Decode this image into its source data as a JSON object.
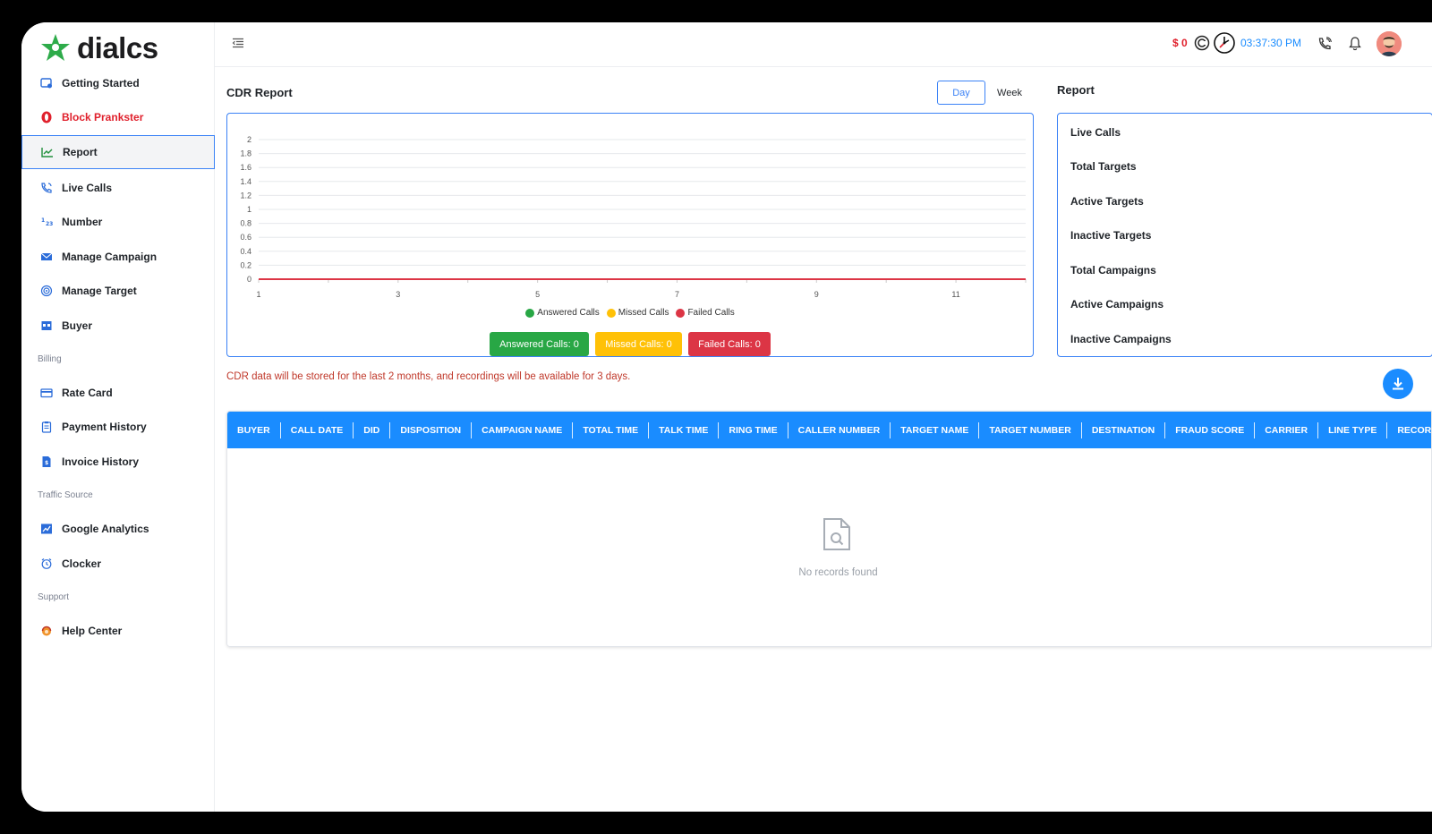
{
  "brand": {
    "name": "dialcs"
  },
  "sidebar": {
    "items": [
      {
        "label": "Getting Started"
      },
      {
        "label": "Block Prankster"
      },
      {
        "label": "Report"
      },
      {
        "label": "Live Calls"
      },
      {
        "label": "Number"
      },
      {
        "label": "Manage Campaign"
      },
      {
        "label": "Manage Target"
      },
      {
        "label": "Buyer"
      }
    ],
    "billing": {
      "heading": "Billing",
      "items": [
        {
          "label": "Rate Card"
        },
        {
          "label": "Payment History"
        },
        {
          "label": "Invoice History"
        }
      ]
    },
    "traffic": {
      "heading": "Traffic Source",
      "items": [
        {
          "label": "Google Analytics"
        },
        {
          "label": "Clocker"
        }
      ]
    },
    "support": {
      "heading": "Support",
      "items": [
        {
          "label": "Help Center"
        }
      ]
    }
  },
  "topbar": {
    "balance": "$ 0",
    "time": "03:37:30 PM"
  },
  "cdr": {
    "title": "CDR Report",
    "toggle": {
      "day": "Day",
      "week": "Week"
    },
    "answered_btn": "Answered Calls: 0",
    "missed_btn": "Missed Calls: 0",
    "failed_btn": "Failed Calls: 0",
    "notice": "CDR data will be stored for the last 2 months, and recordings will be available for 3 days."
  },
  "chart_data": {
    "type": "line",
    "x": [
      1,
      2,
      3,
      4,
      5,
      6,
      7,
      8,
      9,
      10,
      11,
      12
    ],
    "x_tick_labels": [
      "1",
      "3",
      "5",
      "7",
      "9",
      "11"
    ],
    "y_tick_labels": [
      "2",
      "1.8",
      "1.6",
      "1.4",
      "1.2",
      "1",
      "0.8",
      "0.6",
      "0.4",
      "0.2",
      "0"
    ],
    "ylim": [
      0,
      2
    ],
    "series": [
      {
        "name": "Answered Calls",
        "color": "#28a745",
        "values": [
          0,
          0,
          0,
          0,
          0,
          0,
          0,
          0,
          0,
          0,
          0,
          0
        ]
      },
      {
        "name": "Missed Calls",
        "color": "#ffc107",
        "values": [
          0,
          0,
          0,
          0,
          0,
          0,
          0,
          0,
          0,
          0,
          0,
          0
        ]
      },
      {
        "name": "Failed Calls",
        "color": "#dc3545",
        "values": [
          0,
          0,
          0,
          0,
          0,
          0,
          0,
          0,
          0,
          0,
          0,
          0
        ]
      }
    ],
    "grid": true,
    "legend": "bottom"
  },
  "report": {
    "title": "Report",
    "items": [
      {
        "label": "Live Calls"
      },
      {
        "label": "Total Targets"
      },
      {
        "label": "Active Targets"
      },
      {
        "label": "Inactive Targets"
      },
      {
        "label": "Total Campaigns"
      },
      {
        "label": "Active Campaigns"
      },
      {
        "label": "Inactive Campaigns"
      }
    ]
  },
  "table": {
    "columns": [
      "BUYER",
      "CALL DATE",
      "DID",
      "DISPOSITION",
      "CAMPAIGN NAME",
      "TOTAL TIME",
      "TALK TIME",
      "RING TIME",
      "CALLER NUMBER",
      "TARGET NAME",
      "TARGET NUMBER",
      "DESTINATION",
      "FRAUD SCORE",
      "CARRIER",
      "LINE TYPE",
      "RECORDING"
    ],
    "empty_text": "No records found"
  },
  "colors": {
    "accent": "#1a8cff",
    "answered": "#28a745",
    "missed": "#ffc107",
    "failed": "#dc3545"
  }
}
